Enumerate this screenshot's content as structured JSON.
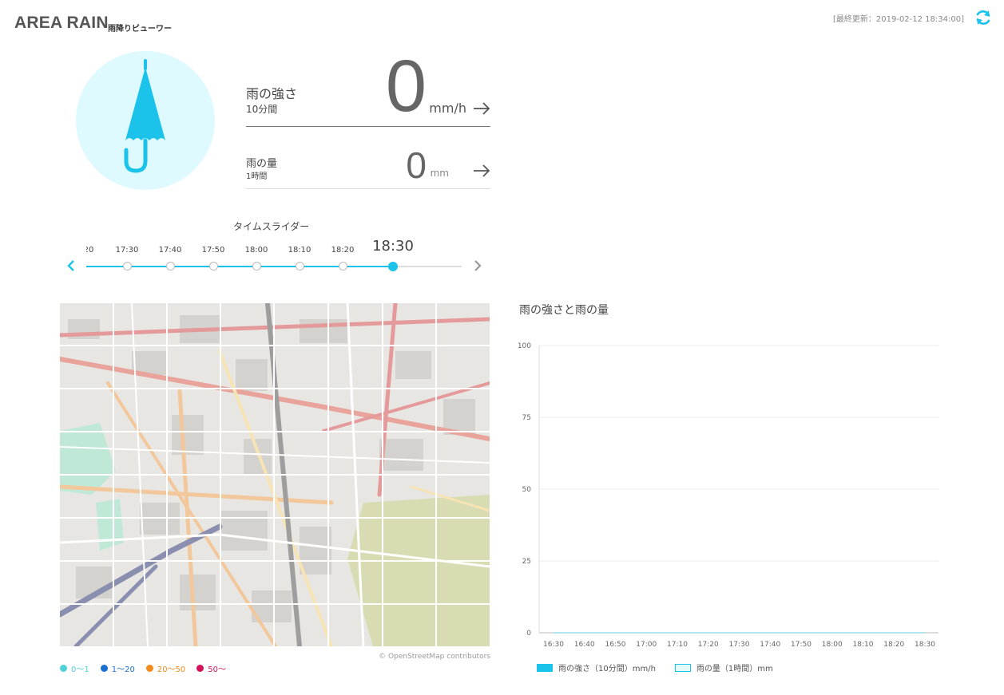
{
  "header": {
    "title": "AREA RAIN",
    "subtitle": "雨降りビューワー",
    "last_updated": "[最終更新：2019-02-12 18:34:00]"
  },
  "colors": {
    "accent": "#1bc3ea",
    "umbrella_bg": "#defaff"
  },
  "intensity": {
    "label": "雨の強さ",
    "sub": "10分間",
    "value": "0",
    "unit": "mm/h"
  },
  "amount": {
    "label": "雨の量",
    "sub": "1時間",
    "value": "0",
    "unit": "mm"
  },
  "slider": {
    "title": "タイムスライダー",
    "partial_label": "20",
    "labels": [
      "17:30",
      "17:40",
      "17:50",
      "18:00",
      "18:10",
      "18:20"
    ],
    "current": "18:30"
  },
  "map": {
    "attribution": "© OpenStreetMap contributors",
    "legend": [
      {
        "label": "0〜1",
        "color": "#4fd1d9"
      },
      {
        "label": "1〜20",
        "color": "#1a6fd0"
      },
      {
        "label": "20〜50",
        "color": "#f28a1c"
      },
      {
        "label": "50〜",
        "color": "#d4145a"
      }
    ]
  },
  "chart_title": "雨の強さと雨の量",
  "chart_data": {
    "type": "bar",
    "title": "雨の強さと雨の量",
    "categories": [
      "16:30",
      "16:40",
      "16:50",
      "17:00",
      "17:10",
      "17:20",
      "17:30",
      "17:40",
      "17:50",
      "18:00",
      "18:10",
      "18:20",
      "18:30"
    ],
    "series": [
      {
        "name": "雨の強さ（10分間）mm/h",
        "values": [
          0,
          0,
          0,
          0,
          0,
          0,
          0,
          0,
          0,
          0,
          0,
          0,
          0
        ],
        "color": "#1bc3ea"
      },
      {
        "name": "雨の量（1時間）mm",
        "values": [
          0,
          0,
          0,
          0,
          0,
          0,
          0,
          0,
          0,
          0,
          0,
          0,
          0
        ],
        "color": "#e4f9fc"
      }
    ],
    "yticks": [
      0,
      25,
      50,
      75,
      100
    ],
    "ylim": [
      0,
      100
    ],
    "grid": true,
    "legend_position": "bottom"
  }
}
